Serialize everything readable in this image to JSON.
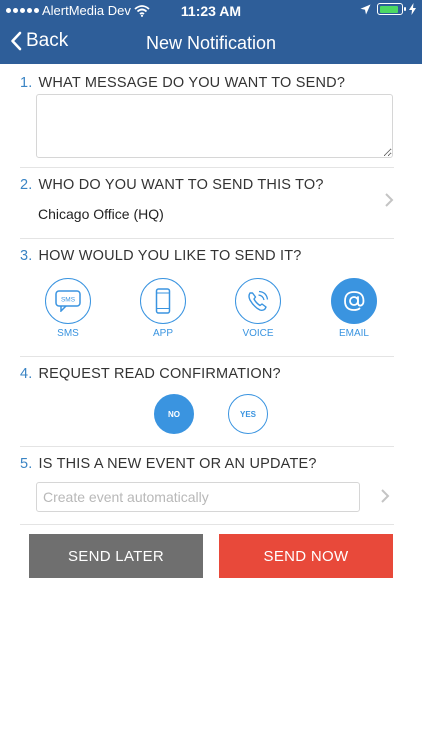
{
  "status_bar": {
    "carrier": "AlertMedia Dev",
    "time": "11:23 AM",
    "battery_level": 0.9
  },
  "nav": {
    "back_label": "Back",
    "title": "New Notification"
  },
  "questions": [
    {
      "number": "1.",
      "title": "WHAT MESSAGE DO YOU WANT TO SEND?"
    },
    {
      "number": "2.",
      "title": "WHO DO YOU WANT TO SEND THIS TO?"
    },
    {
      "number": "3.",
      "title": "HOW WOULD YOU LIKE TO SEND IT?"
    },
    {
      "number": "4.",
      "title": "REQUEST READ CONFIRMATION?"
    },
    {
      "number": "5.",
      "title": "IS THIS A NEW EVENT OR AN UPDATE?"
    }
  ],
  "message": {
    "value": ""
  },
  "recipient": "Chicago Office (HQ)",
  "methods": [
    {
      "label": "SMS",
      "icon": "sms-icon",
      "selected": false
    },
    {
      "label": "APP",
      "icon": "phone-icon",
      "selected": false
    },
    {
      "label": "VOICE",
      "icon": "voice-call-icon",
      "selected": false
    },
    {
      "label": "EMAIL",
      "icon": "at-sign-icon",
      "selected": true
    }
  ],
  "sms_icon_text": "SMS",
  "confirmation": {
    "no_label": "NO",
    "yes_label": "YES",
    "selected": "NO"
  },
  "event": {
    "placeholder": "Create event automatically",
    "value": ""
  },
  "buttons": {
    "send_later": "SEND LATER",
    "send_now": "SEND NOW"
  },
  "colors": {
    "header": "#2e5e99",
    "accent": "#3a94e0",
    "send_now": "#e8493a",
    "send_later": "#6f6f6f"
  }
}
